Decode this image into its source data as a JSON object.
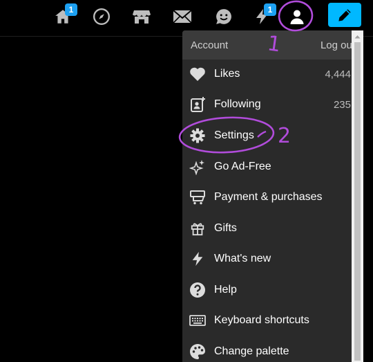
{
  "topbar": {
    "icons": [
      {
        "name": "home-icon",
        "badge": "1"
      },
      {
        "name": "explore-icon"
      },
      {
        "name": "shop-icon"
      },
      {
        "name": "mail-icon"
      },
      {
        "name": "chat-icon"
      },
      {
        "name": "activity-icon",
        "badge": "1"
      },
      {
        "name": "account-icon"
      }
    ],
    "compose": "pencil-icon"
  },
  "menu": {
    "header": {
      "title": "Account",
      "logout": "Log out"
    },
    "items": [
      {
        "label": "Likes",
        "count": "4,444",
        "icon": "heart-icon"
      },
      {
        "label": "Following",
        "count": "235",
        "icon": "following-icon"
      },
      {
        "label": "Settings",
        "count": "",
        "icon": "gear-icon"
      },
      {
        "label": "Go Ad-Free",
        "count": "",
        "icon": "sparkle-icon"
      },
      {
        "label": "Payment & purchases",
        "count": "",
        "icon": "cart-icon"
      },
      {
        "label": "Gifts",
        "count": "",
        "icon": "gift-icon"
      },
      {
        "label": "What's new",
        "count": "",
        "icon": "lightning-icon"
      },
      {
        "label": "Help",
        "count": "",
        "icon": "help-icon"
      },
      {
        "label": "Keyboard shortcuts",
        "count": "",
        "icon": "keyboard-icon"
      },
      {
        "label": "Change palette",
        "count": "",
        "icon": "palette-icon"
      }
    ]
  },
  "annotations": {
    "mark1": "1",
    "mark2": "2",
    "color": "#b14cdb"
  },
  "colors": {
    "accent": "#00b8ff",
    "badge": "#1da1f2",
    "menu_bg": "#2a2a2a",
    "menu_header_bg": "#3b3b3b"
  }
}
